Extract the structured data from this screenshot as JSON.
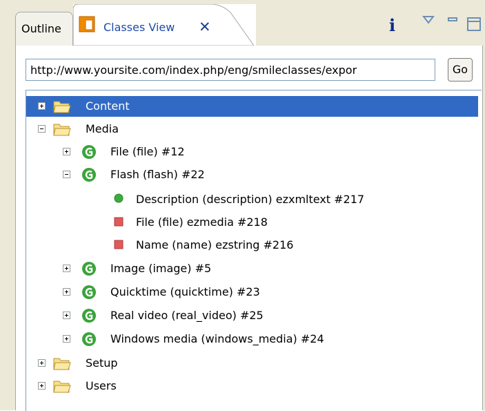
{
  "tabs": {
    "outline_label": "Outline",
    "classes_label": "Classes View",
    "close_glyph": "✕",
    "info_glyph": "i"
  },
  "url_bar": {
    "value": "http://www.yoursite.com/index.php/eng/smileclasses/expor",
    "go_label": "Go"
  },
  "tree": {
    "content": "Content",
    "media": "Media",
    "file": "File (file)  #12",
    "flash": "Flash (flash)  #22",
    "attr_description": "Description (description) ezxmltext #217",
    "attr_file": "File (file) ezmedia #218",
    "attr_name": "Name (name) ezstring #216",
    "image": "Image (image)  #5",
    "quicktime": "Quicktime (quicktime)  #23",
    "real_video": "Real video (real_video)  #25",
    "windows_media": "Windows media (windows_media)  #24",
    "setup": "Setup",
    "users": "Users"
  },
  "colors": {
    "selection": "#316ac5",
    "folder": "#f5d76e",
    "class_icon": "#3aa33a",
    "attr_green": "#3cad3c",
    "attr_red": "#e05a5a"
  }
}
